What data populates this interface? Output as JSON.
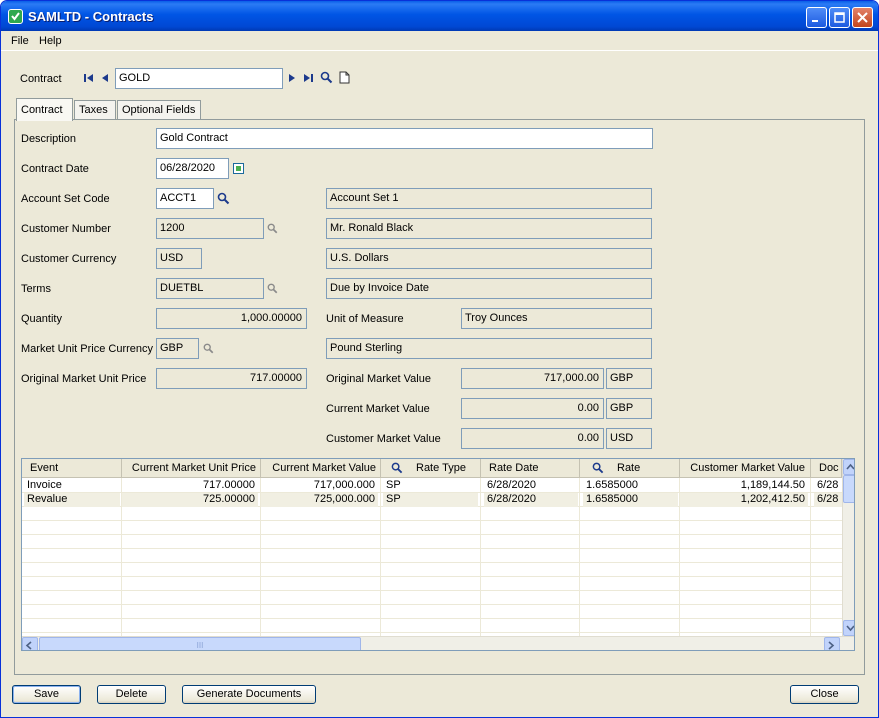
{
  "window": {
    "title": "SAMLTD - Contracts"
  },
  "menu": {
    "file": "File",
    "help": "Help"
  },
  "contract_bar": {
    "label": "Contract",
    "value": "GOLD"
  },
  "tabs": [
    {
      "label": "Contract"
    },
    {
      "label": "Taxes"
    },
    {
      "label": "Optional Fields"
    }
  ],
  "form": {
    "description": {
      "label": "Description",
      "value": "Gold Contract"
    },
    "contract_date": {
      "label": "Contract Date",
      "value": "06/28/2020"
    },
    "account_set": {
      "label": "Account Set Code",
      "value": "ACCT1",
      "desc": "Account Set 1"
    },
    "customer_number": {
      "label": "Customer Number",
      "value": "1200",
      "desc": "Mr. Ronald Black"
    },
    "customer_currency": {
      "label": "Customer Currency",
      "value": "USD",
      "desc": "U.S. Dollars"
    },
    "terms": {
      "label": "Terms",
      "value": "DUETBL",
      "desc": "Due by Invoice Date"
    },
    "quantity": {
      "label": "Quantity",
      "value": "1,000.00000"
    },
    "unit_of_measure": {
      "label": "Unit of Measure",
      "value": "Troy Ounces"
    },
    "market_currency": {
      "label": "Market Unit Price Currency",
      "value": "GBP",
      "desc": "Pound Sterling"
    },
    "original_unit_price": {
      "label": "Original Market Unit Price",
      "value": "717.00000"
    },
    "original_market_value": {
      "label": "Original Market Value",
      "value": "717,000.00",
      "currency": "GBP"
    },
    "current_market_value": {
      "label": "Current Market Value",
      "value": "0.00",
      "currency": "GBP"
    },
    "customer_market_value": {
      "label": "Customer Market Value",
      "value": "0.00",
      "currency": "USD"
    }
  },
  "grid": {
    "columns": [
      "Event",
      "Current Market Unit Price",
      "Current Market Value",
      "Rate Type",
      "Rate Date",
      "Rate",
      "Customer Market Value",
      "Doc"
    ],
    "rows": [
      [
        "Invoice",
        "717.00000",
        "717,000.000",
        "SP",
        "6/28/2020",
        "1.6585000",
        "1,189,144.50",
        "6/28"
      ],
      [
        "Revalue",
        "725.00000",
        "725,000.000",
        "SP",
        "6/28/2020",
        "1.6585000",
        "1,202,412.50",
        "6/28"
      ]
    ],
    "hscroll_thumb": "III"
  },
  "buttons": {
    "save": "Save",
    "delete": "Delete",
    "generate": "Generate Documents",
    "close": "Close"
  },
  "colors": {
    "titlebar": "#0055e5",
    "window_bg": "#ece9d8",
    "field_border": "#7f9db9"
  }
}
